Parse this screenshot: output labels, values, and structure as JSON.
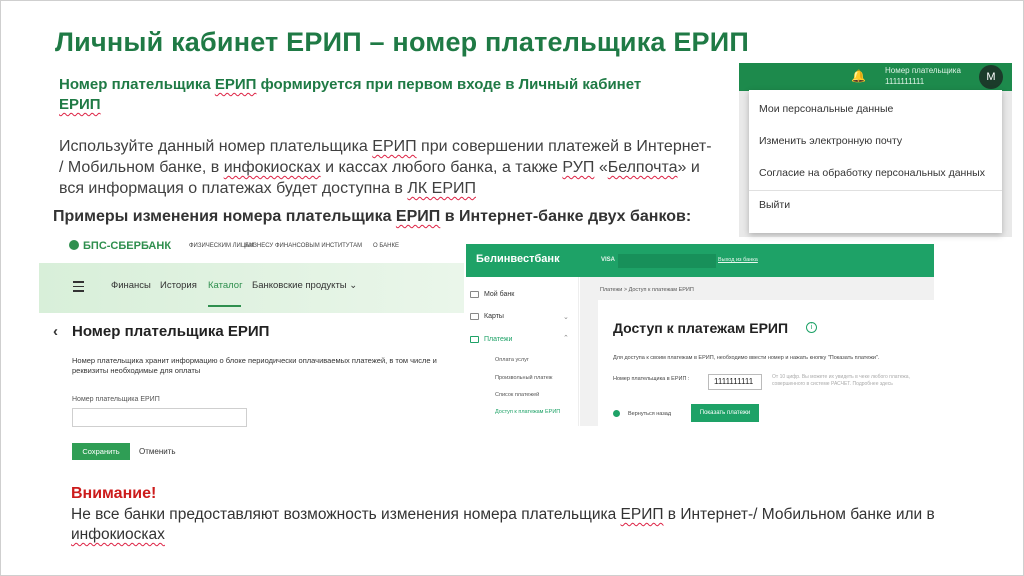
{
  "slide": {
    "title": "Личный кабинет ЕРИП – номер плательщика ЕРИП",
    "subtitle_part1": "Номер плательщика ",
    "subtitle_erip": "ЕРИП",
    "subtitle_part2": " формируется при первом входе в Личный кабинет ",
    "subtitle_part3": "ЕРИП",
    "para_1": "Используйте данный номер плательщика ",
    "para_erip": "ЕРИП",
    "para_2": " при совершении платежей в Интернет- / Мобильном банке, в ",
    "para_infokiosk": "инфокиосках",
    "para_3": " и кассах любого банка, а также ",
    "para_rup": "РУП",
    "para_4": " «",
    "para_belpochta": "Белпочта",
    "para_5": "» и вся информация о платежах будет доступна в ",
    "para_lk": "ЛК ЕРИП",
    "examples_1": "Примеры изменения номера плательщика ",
    "examples_erip": "ЕРИП",
    "examples_2": " в Интернет-банке двух банков:",
    "warning_title": "Внимание!",
    "warning_1": "Не все банки предоставляют возможность изменения номера плательщика ",
    "warning_erip": "ЕРИП",
    "warning_2": " в Интернет-/ Мобильном банке или в ",
    "warning_infokiosk": "инфокиосках"
  },
  "profile_menu": {
    "name_label": "Номер плательщика",
    "number": "1111111111",
    "avatar_letter": "M",
    "items": [
      "Мои персональные данные",
      "Изменить электронную почту",
      "Согласие на обработку персональных данных",
      "Выйти"
    ]
  },
  "bps": {
    "logo": "БПС-СБЕРБАНК",
    "top_links": [
      "ФИЗИЧЕСКИМ ЛИЦАМ",
      "БИЗНЕСУ",
      "ФИНАНСОВЫМ ИНСТИТУТАМ",
      "О БАНКЕ"
    ],
    "nav": [
      "Финансы",
      "История",
      "Каталог",
      "Банковские продукты ⌄"
    ],
    "back_arrow": "‹",
    "heading": "Номер плательщика ЕРИП",
    "description": "Номер плательщика хранит информацию о блоке периодически оплачиваемых платежей, в том числе и реквизиты необходимые для оплаты",
    "field_label": "Номер плательщика ЕРИП",
    "save": "Сохранить",
    "cancel": "Отменить"
  },
  "belinvest": {
    "logo": "Белинвестбанк",
    "visa": "VISA",
    "top_link": "Выход из банка",
    "sidebar": [
      "Мой банк",
      "Карты",
      "Платежи"
    ],
    "submenu": [
      "Оплата услуг",
      "Произвольный платеж",
      "Список платежей",
      "Доступ к платежам ЕРИП"
    ],
    "breadcrumb": "Платежи   >   Доступ к платежам ЕРИП",
    "heading": "Доступ к платежам ЕРИП",
    "info_icon": "i",
    "description": "Для доступа к своим платежам в ЕРИП, необходимо ввести номер и нажать кнопку \"Показать платежи\".",
    "field_label": "Номер плательщика в ЕРИП :",
    "field_value": "1111111111",
    "hint": "От 10 цифр. Вы можете их увидеть в чеке любого платежа, совершенного в системе РАСЧЕТ. Подробнее здесь",
    "back": "Вернуться назад",
    "button": "Показать платежи"
  },
  "colors": {
    "title_green": "#1f7a45",
    "bps_green": "#2f9e55",
    "belinvest_green": "#1ea267",
    "warning_red": "#cc1b1b"
  }
}
